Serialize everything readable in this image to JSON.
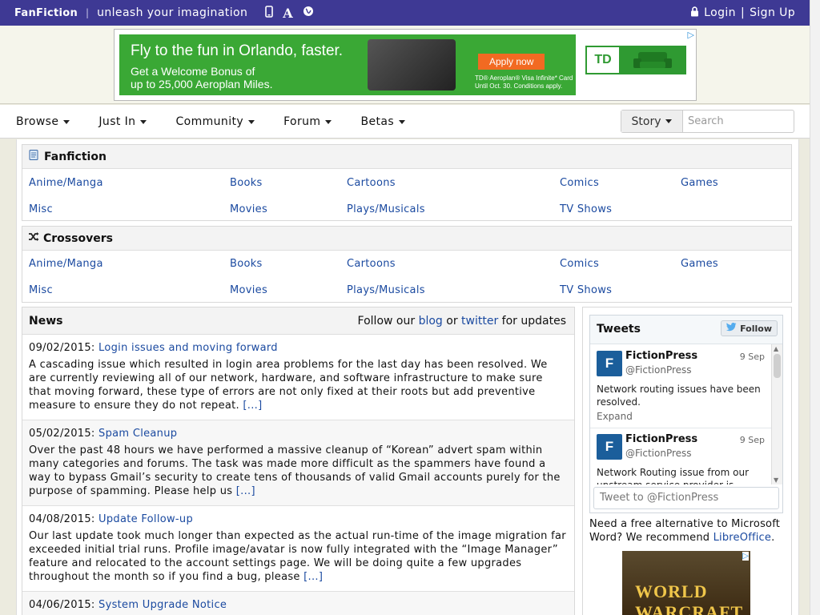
{
  "topbar": {
    "logo": "FanFiction",
    "separator": "|",
    "tagline": "unleash your imagination",
    "icons": [
      "mobile-icon",
      "font-icon",
      "globe-icon"
    ],
    "login": "Login",
    "signup_sep": "|",
    "signup": "Sign Up"
  },
  "ad_top": {
    "headline": "Fly to the fun in Orlando, faster.",
    "line1": "Get a Welcome Bonus of",
    "line2": "up to 25,000 Aeroplan Miles.",
    "apply": "Apply now",
    "fine1": "TD® Aeroplan® Visa Infinite* Card",
    "fine2": "Until Oct. 30. Conditions apply.",
    "brand": "TD"
  },
  "nav": {
    "menus": [
      "Browse",
      "Just In",
      "Community",
      "Forum",
      "Betas"
    ],
    "search_type": "Story",
    "search_placeholder": "Search"
  },
  "fanfiction": {
    "title": "Fanfiction",
    "row1": [
      "Anime/Manga",
      "Books",
      "Cartoons",
      "Comics",
      "Games"
    ],
    "row2": [
      "Misc",
      "Movies",
      "Plays/Musicals",
      "TV Shows"
    ]
  },
  "crossovers": {
    "title": "Crossovers",
    "row1": [
      "Anime/Manga",
      "Books",
      "Cartoons",
      "Comics",
      "Games"
    ],
    "row2": [
      "Misc",
      "Movies",
      "Plays/Musicals",
      "TV Shows"
    ]
  },
  "news": {
    "title": "News",
    "follow_pre": "Follow our",
    "follow_blog": "blog",
    "follow_or": "or",
    "follow_twitter": "twitter",
    "follow_post": "for updates",
    "items": [
      {
        "date": "09/02/2015:",
        "title": "Login issues and moving forward",
        "body": "A cascading issue which resulted in login area problems for the last day has been resolved. We are currently reviewing all of our network, hardware, and software infrastructure to make sure that moving forward, these type of errors are not only fixed at their roots but add preventive measure to ensure they do not repeat.",
        "more": "[...]"
      },
      {
        "date": "05/02/2015:",
        "title": "Spam Cleanup",
        "body": "Over the past 48 hours we have performed a massive cleanup of “Korean” advert spam within many categories and forums. The task was made more difficult as the spammers have found a way to bypass Gmail’s security to create tens of thousands of valid Gmail accounts purely for the purpose of spamming. Please help us",
        "more": "[...]"
      },
      {
        "date": "04/08/2015:",
        "title": "Update Follow-up",
        "body": "Our last update took much longer than expected as the actual run-time of the image migration far exceeded initial trial runs. Profile image/avatar is now fully integrated with the “Image Manager” feature and relocated to the account settings page. We will be doing quite a few upgrades throughout the month so if you find a bug, please",
        "more": "[...]"
      },
      {
        "date": "04/06/2015:",
        "title": "System Upgrade Notice",
        "body": "",
        "more": ""
      }
    ]
  },
  "tweets": {
    "title": "Tweets",
    "follow": "Follow",
    "items": [
      {
        "name": "FictionPress",
        "handle": "@FictionPress",
        "date": "9 Sep",
        "text": "Network routing issues have been resolved.",
        "expand": "Expand"
      },
      {
        "name": "FictionPress",
        "handle": "@FictionPress",
        "date": "9 Sep",
        "text": "Network Routing issue from our upstream service provider is",
        "expand": ""
      }
    ],
    "compose_placeholder": "Tweet to @FictionPress"
  },
  "sidebar": {
    "recommend_pre": "Need a free alternative to Microsoft Word? We recommend",
    "recommend_link": "LibreOffice",
    "recommend_post": "."
  },
  "ad_side": {
    "text": "WORLD WARCRAFT"
  },
  "colors": {
    "topbar": "#3e3994",
    "link": "#1b4aa0",
    "ad_green": "#3aa835"
  }
}
